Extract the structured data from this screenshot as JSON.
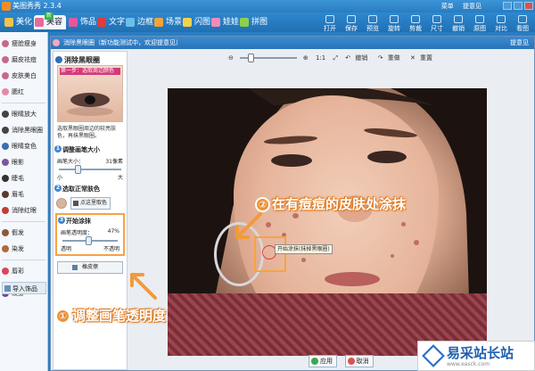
{
  "app": {
    "title": "美图秀秀 2.3.4",
    "menus": [
      "菜单",
      "提意见"
    ]
  },
  "toolbar": {
    "tabs": [
      "美化",
      "美容",
      "饰品",
      "文字",
      "边框",
      "场景",
      "闪图",
      "娃娃",
      "拼图"
    ],
    "new_badge": "新",
    "right_tools": [
      "打开",
      "保存",
      "预览",
      "旋转",
      "剪裁",
      "尺寸",
      "撤销",
      "原图",
      "对比",
      "看图"
    ]
  },
  "sidebar": {
    "items": [
      "瘦脸瘦身",
      "磨皮祛痘",
      "皮肤美白",
      "腮红",
      "眼睛放大",
      "消除黑眼圈",
      "眼睛变色",
      "眼影",
      "睫毛",
      "眉毛",
      "消除红眼",
      "假发",
      "染发",
      "唇彩",
      "纹身"
    ],
    "import_label": "导入饰品"
  },
  "dialog": {
    "title": "消除黑眼圈（新功能测试中，欢迎提意见）",
    "help": "提意见",
    "panel": {
      "heading": "消除黑眼圈",
      "preview_caption": "第一步：选取周边颜色",
      "description": "选取黑眼圈周边的较亮肤色，再抹黑眼圈。",
      "step1": {
        "title": "调整画笔大小",
        "label": "画笔大小：",
        "value": "31像素",
        "min": "小",
        "max": "大",
        "level": 0.3
      },
      "step2": {
        "title": "选取正常肤色",
        "pick_button": "点这里取色",
        "skin_color": "#d6b59e"
      },
      "step3": {
        "title": "开始涂抹",
        "label": "画笔透明度：",
        "value": "47%",
        "min": "透明",
        "max": "不透明",
        "level": 0.47
      },
      "eraser_button": "橡皮擦"
    },
    "viewbar": {
      "zoom_label": "1:1",
      "undo": "撤销",
      "redo": "重做",
      "reset": "重置"
    },
    "canvas": {
      "tooltip": "开始涂抹(抹掉黑眼圈)"
    },
    "buttons": {
      "apply": "应用",
      "cancel": "取消"
    }
  },
  "annotations": {
    "one": {
      "num": "①",
      "text": "调整画笔透明度"
    },
    "two": {
      "num": "②",
      "text": "在有痘痘的皮肤处涂抹"
    }
  },
  "watermark": {
    "title": "易采站长站",
    "url": "www.easck.com"
  }
}
